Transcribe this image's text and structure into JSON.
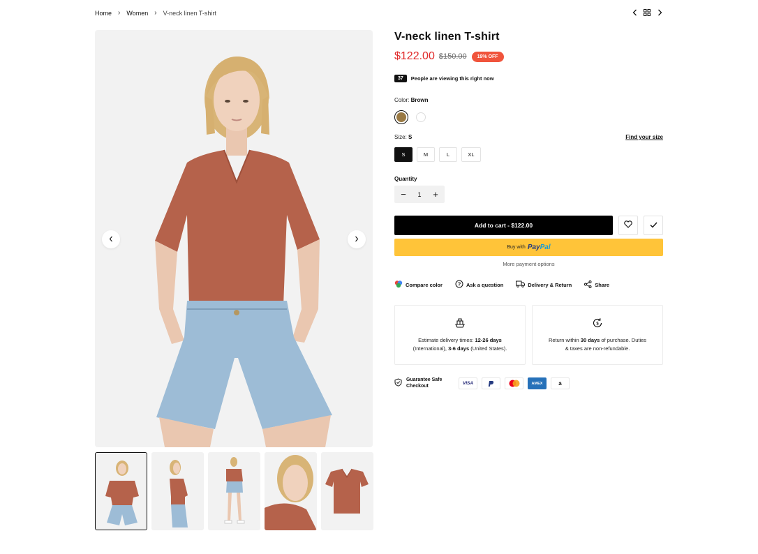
{
  "breadcrumb": {
    "home": "Home",
    "category": "Women",
    "current": "V-neck linen T-shirt"
  },
  "product": {
    "title": "V-neck linen T-shirt",
    "price": "$122.00",
    "compare_price": "$150.00",
    "discount_badge": "19% OFF",
    "viewers_count": "37",
    "viewers_text": "People are viewing this right now"
  },
  "color": {
    "label": "Color:",
    "selected": "Brown",
    "swatches": [
      "#9a7a44",
      "#ffffff"
    ]
  },
  "size": {
    "label": "Size:",
    "selected": "S",
    "find_size": "Find your size",
    "options": [
      "S",
      "M",
      "L",
      "XL"
    ]
  },
  "quantity": {
    "label": "Quantity",
    "value": "1",
    "minus": "−",
    "plus": "+"
  },
  "cart": {
    "add_label": "Add to cart - $122.00",
    "paypal_prefix": "Buy with",
    "paypal_brand_1": "Pay",
    "paypal_brand_2": "Pal",
    "more_options": "More payment options"
  },
  "actions": {
    "compare": "Compare color",
    "question": "Ask a question",
    "delivery": "Delivery & Return",
    "share": "Share"
  },
  "delivery_box": {
    "text_1": "Estimate delivery times: ",
    "bold_1": "12-26 days",
    "text_2": "(International), ",
    "bold_2": "3-6 days",
    "text_3": " (United States)."
  },
  "return_box": {
    "text_1": "Return within ",
    "bold_1": "30 days",
    "text_2": " of purchase. Duties",
    "text_3": "& taxes are non-refundable."
  },
  "checkout": {
    "guarantee_line_1": "Guarantee Safe",
    "guarantee_line_2": "Checkout",
    "payments": {
      "visa": "VISA",
      "amex": "AMEX",
      "amazon": "a"
    }
  },
  "colors": {
    "price_red": "#e02a2a",
    "badge_orange": "#f0543c",
    "paypal_yellow": "#ffc439",
    "shirt": "#b5624b",
    "denim": "#9dbcd6"
  },
  "icons": {
    "topnav": [
      "chevron-left-icon",
      "grid-icon",
      "chevron-right-icon"
    ],
    "image_nav": [
      "chevron-left-icon",
      "chevron-right-icon"
    ],
    "actions": [
      "color-palette-icon",
      "question-circle-icon",
      "truck-icon",
      "share-icon"
    ]
  }
}
